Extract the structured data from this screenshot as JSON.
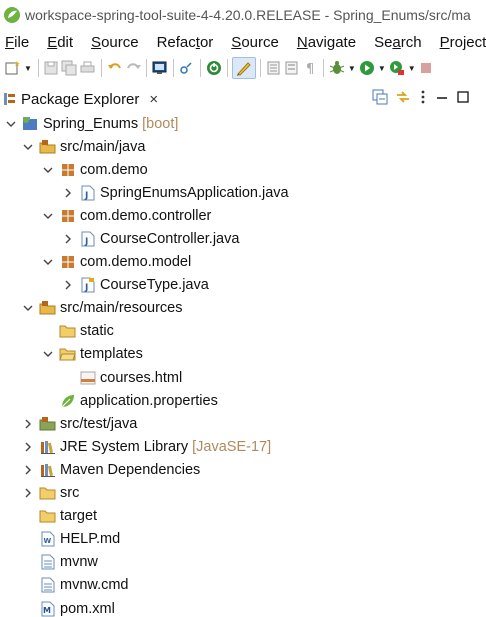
{
  "window": {
    "title": "workspace-spring-tool-suite-4-4.20.0.RELEASE - Spring_Enums/src/ma"
  },
  "menu": [
    "File",
    "Edit",
    "Source",
    "Refactor",
    "Source",
    "Navigate",
    "Search",
    "Project"
  ],
  "menu_mnemonic": [
    "F",
    "E",
    "S",
    "t",
    "S",
    "N",
    "a",
    "P"
  ],
  "view": {
    "title": "Package Explorer",
    "close": "×"
  },
  "toolbar_icons": [
    "new-icon",
    "save-icon",
    "save-all-icon",
    "undo-icon",
    "redo-icon",
    "console-icon",
    "link-icon",
    "spring-boot-icon",
    "annotation-icon",
    "outline-icon",
    "task-icon",
    "paragraph-icon",
    "debug-icon",
    "run-icon",
    "coverage-icon",
    "stop-icon"
  ],
  "tree": {
    "project": {
      "label": "Spring_Enums",
      "decoration": "[boot]"
    },
    "items": [
      {
        "label": "src/main/java"
      },
      {
        "label": "com.demo"
      },
      {
        "label": "SpringEnumsApplication.java"
      },
      {
        "label": "com.demo.controller"
      },
      {
        "label": "CourseController.java"
      },
      {
        "label": "com.demo.model"
      },
      {
        "label": "CourseType.java"
      },
      {
        "label": "src/main/resources"
      },
      {
        "label": "static"
      },
      {
        "label": "templates"
      },
      {
        "label": "courses.html"
      },
      {
        "label": "application.properties"
      },
      {
        "label": "src/test/java"
      },
      {
        "label": "JRE System Library",
        "decoration": "[JavaSE-17]"
      },
      {
        "label": "Maven Dependencies"
      },
      {
        "label": "src"
      },
      {
        "label": "target"
      },
      {
        "label": "HELP.md"
      },
      {
        "label": "mvnw"
      },
      {
        "label": "mvnw.cmd"
      },
      {
        "label": "pom.xml"
      }
    ]
  },
  "colors": {
    "decoration": "#b08a5c",
    "selection": "#dbe8f7",
    "package": "#b5651d",
    "folder": "#e8b84a"
  }
}
